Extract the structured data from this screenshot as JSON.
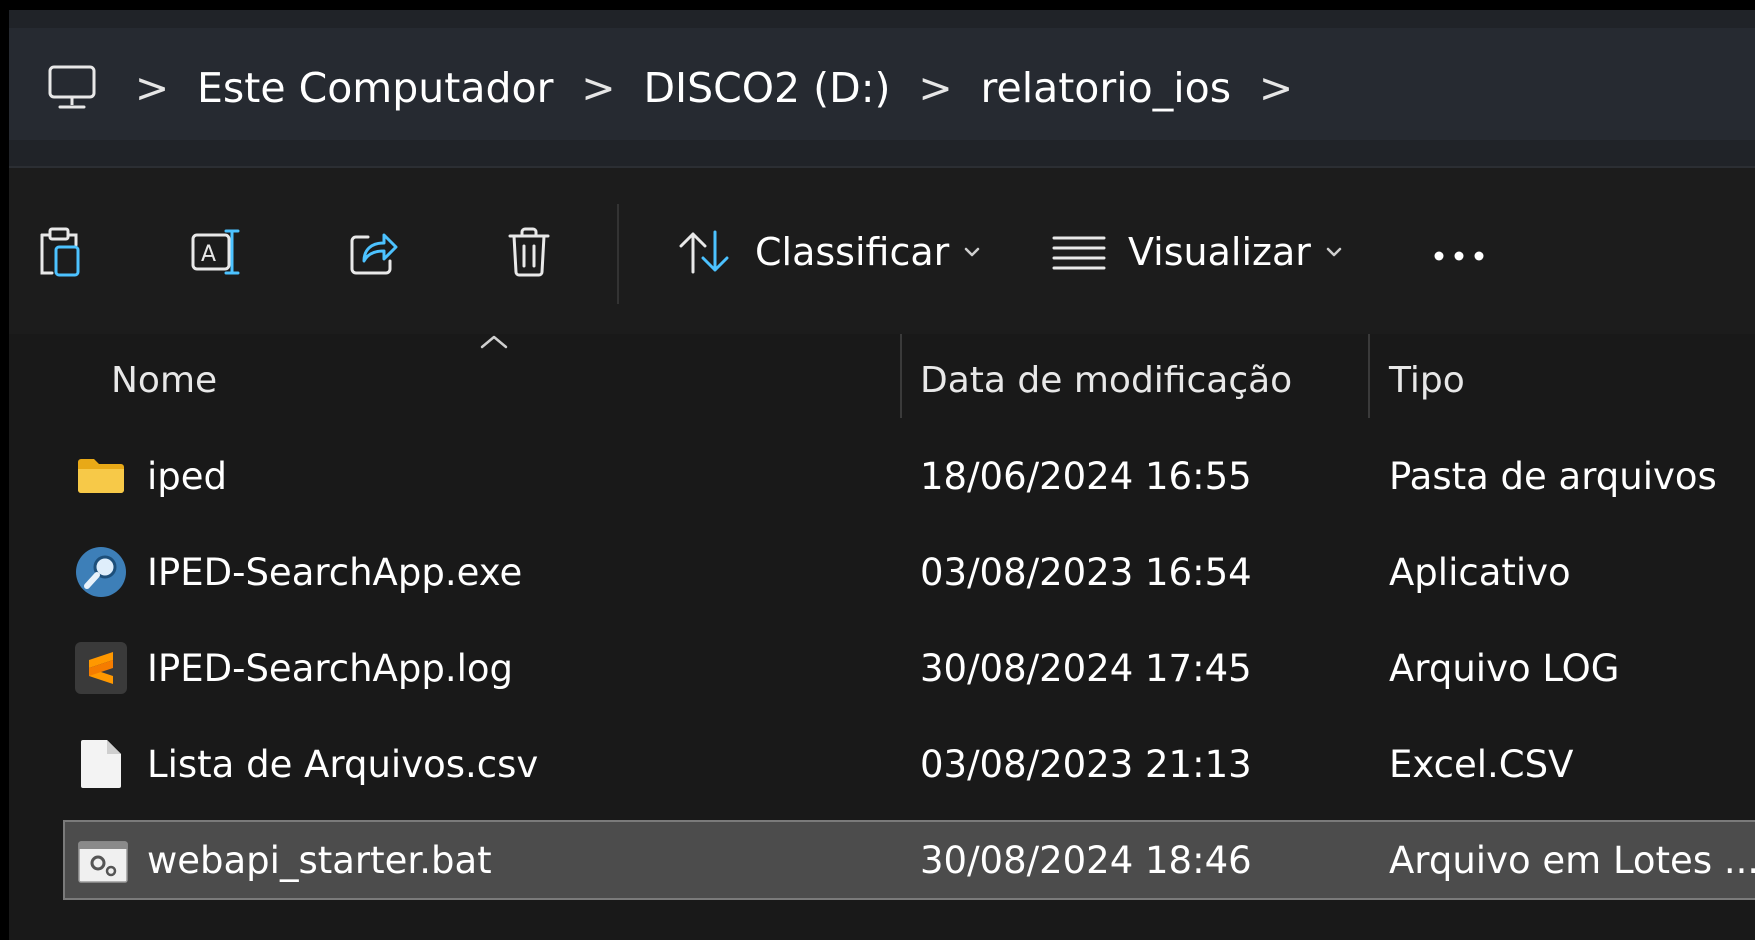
{
  "breadcrumb": {
    "items": [
      "Este Computador",
      "DISCO2 (D:)",
      "relatorio_ios"
    ],
    "separator": ">"
  },
  "toolbar": {
    "sort_label": "Classificar",
    "view_label": "Visualizar"
  },
  "columns": {
    "name": "Nome",
    "date": "Data de modificação",
    "type": "Tipo"
  },
  "files": [
    {
      "name": "iped",
      "date": "18/06/2024 16:55",
      "type": "Pasta de arquivos",
      "icon": "folder-icon"
    },
    {
      "name": "IPED-SearchApp.exe",
      "date": "03/08/2023 16:54",
      "type": "Aplicativo",
      "icon": "search-app-icon"
    },
    {
      "name": "IPED-SearchApp.log",
      "date": "30/08/2024 17:45",
      "type": "Arquivo LOG",
      "icon": "sublime-text-icon"
    },
    {
      "name": "Lista de Arquivos.csv",
      "date": "03/08/2023 21:13",
      "type": "Excel.CSV",
      "icon": "blank-file-icon"
    },
    {
      "name": "webapi_starter.bat",
      "date": "30/08/2024 18:46",
      "type": "Arquivo em Lotes ...",
      "icon": "batch-file-icon",
      "selected": true
    }
  ],
  "colors": {
    "accent_blue": "#4cc2ff",
    "folder_yellow": "#f7c948",
    "selection": "#4c4c4c"
  }
}
